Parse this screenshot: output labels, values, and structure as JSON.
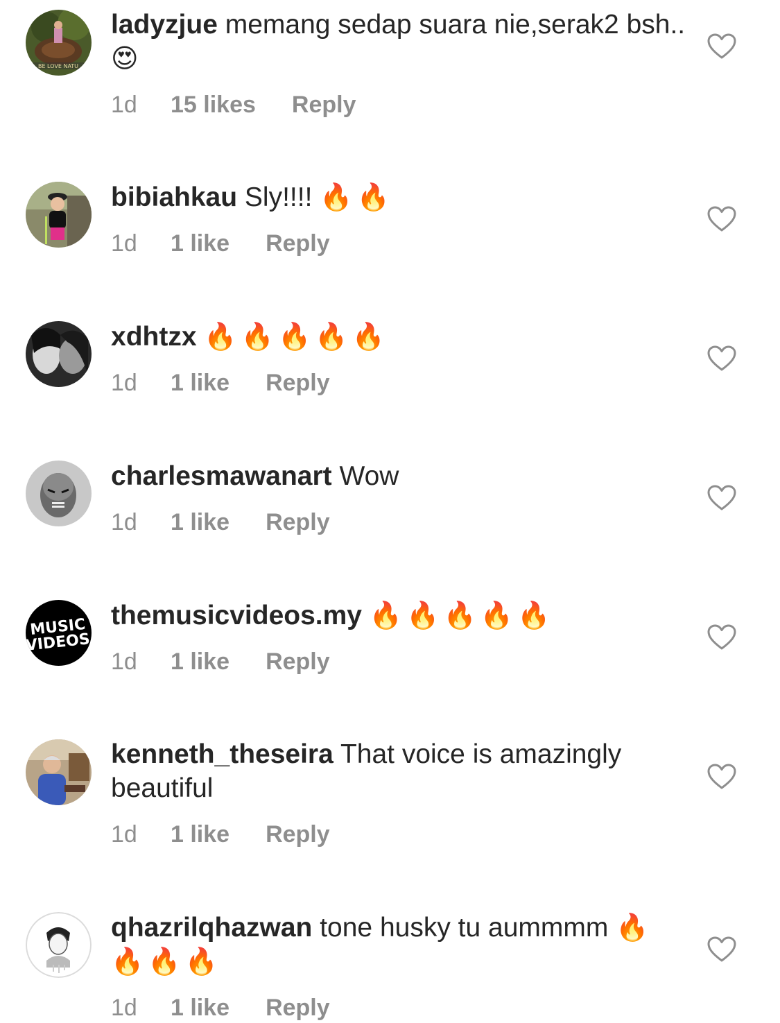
{
  "comments": [
    {
      "username": "ladyzjue",
      "text": "memang sedap suara nie,serak2 bsh..",
      "emoji": "😍",
      "time": "1d",
      "likes": "15 likes",
      "reply": "Reply",
      "avatar_icon": "avatar-photo-nature-icon",
      "avatar_badge": "BE LOVE NATU"
    },
    {
      "username": "bibiahkau",
      "text": "Sly!!!!",
      "emoji": "🔥🔥",
      "time": "1d",
      "likes": "1 like",
      "reply": "Reply",
      "avatar_icon": "avatar-photo-child-icon"
    },
    {
      "username": "xdhtzx",
      "text": "",
      "emoji": "🔥🔥🔥🔥🔥",
      "time": "1d",
      "likes": "1 like",
      "reply": "Reply",
      "avatar_icon": "avatar-photo-bw-faces-icon"
    },
    {
      "username": "charlesmawanart",
      "text": "Wow",
      "emoji": "",
      "time": "1d",
      "likes": "1 like",
      "reply": "Reply",
      "avatar_icon": "avatar-photo-bw-man-icon"
    },
    {
      "username": "themusicvideos.my",
      "text": "",
      "emoji": "🔥🔥🔥🔥🔥",
      "time": "1d",
      "likes": "1 like",
      "reply": "Reply",
      "avatar_icon": "avatar-logo-music-videos-icon",
      "avatar_logo_line1": "MUSIC",
      "avatar_logo_line2": "VIDEOS"
    },
    {
      "username": "kenneth_theseira",
      "text": "That voice is amazingly beautiful",
      "emoji": "",
      "time": "1d",
      "likes": "1 like",
      "reply": "Reply",
      "avatar_icon": "avatar-photo-man-cafe-icon"
    },
    {
      "username": "qhazrilqhazwan",
      "text": "tone husky tu aummmm",
      "emoji": "🔥🔥🔥🔥",
      "time": "1d",
      "likes": "1 like",
      "reply": "Reply",
      "avatar_icon": "avatar-drawing-icon"
    }
  ],
  "heart_icon": "heart-outline-icon",
  "colors": {
    "text": "#262626",
    "meta": "#8e8e8e",
    "heart_stroke": "#8e8e8e"
  }
}
